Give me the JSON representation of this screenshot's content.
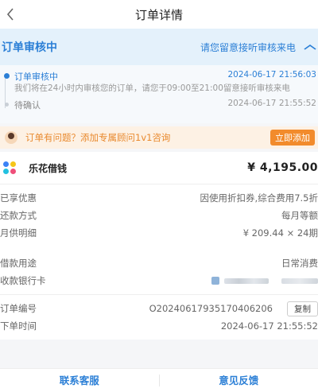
{
  "header": {
    "back_icon": "chevron-left-icon",
    "title": "订单详情"
  },
  "status": {
    "label": "订单审核中",
    "notice": "请您留意接听审核来电",
    "toggle_icon": "chevron-up-icon"
  },
  "timeline": [
    {
      "name": "订单审核中",
      "time": "2024-06-17 21:56:03",
      "desc": "我们将在24小时内审核您的订单，请您于09:00至21:00留意接听审核来电",
      "state": "active"
    },
    {
      "name": "待确认",
      "time": "2024-06-17 21:55:52",
      "desc": "",
      "state": "done"
    }
  ],
  "promo": {
    "text": "订单有问题？添加专属顾问1v1咨询",
    "button": "立即添加"
  },
  "product": {
    "name": "乐花借钱",
    "amount": "¥ 4,195.00"
  },
  "details": [
    {
      "key": "已享优惠",
      "value": "因使用折扣券,综合费用7.5折"
    },
    {
      "key": "还款方式",
      "value": "每月等额"
    },
    {
      "key": "月供明细",
      "value": "¥ 209.44 × 24期"
    }
  ],
  "loan": [
    {
      "key": "借款用途",
      "value": "日常消费"
    },
    {
      "key": "收款银行卡",
      "value": ""
    }
  ],
  "order": {
    "no_label": "订单编号",
    "no_value": "O20240617935170406206",
    "copy_label": "复制",
    "time_label": "下单时间",
    "time_value": "2024-06-17 21:55:52"
  },
  "footer": {
    "service": "联系客服",
    "feedback": "意见反馈"
  },
  "colors": {
    "primary": "#2b7fd6",
    "orange": "#f28b2c",
    "status_bg": "#e4f1fb",
    "promo_bg": "#fdf1e4"
  }
}
